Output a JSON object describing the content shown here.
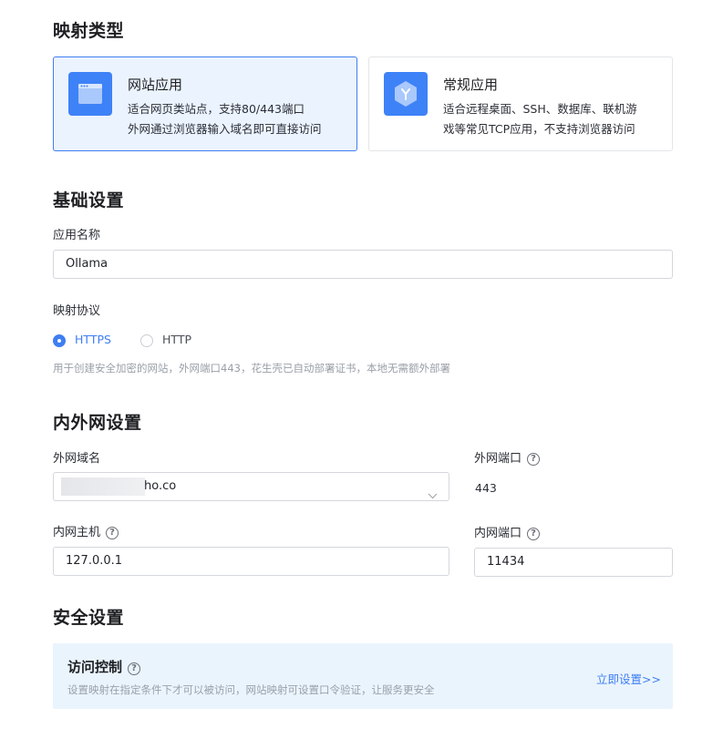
{
  "mapping_type": {
    "title": "映射类型",
    "options": [
      {
        "title": "网站应用",
        "desc_line1": "适合网页类站点，支持80/443端口",
        "desc_line2": "外网通过浏览器输入域名即可直接访问",
        "selected": true,
        "icon": "browser-window-icon"
      },
      {
        "title": "常规应用",
        "desc_line1": "适合远程桌面、SSH、数据库、联机游",
        "desc_line2": "戏等常见TCP应用，不支持浏览器访问",
        "selected": false,
        "icon": "hexagon-y-icon"
      }
    ]
  },
  "basic": {
    "title": "基础设置",
    "app_name_label": "应用名称",
    "app_name_value": "Ollama",
    "protocol_label": "映射协议",
    "protocols": [
      {
        "label": "HTTPS",
        "checked": true
      },
      {
        "label": "HTTP",
        "checked": false
      }
    ],
    "protocol_hint": "用于创建安全加密的网站，外网端口443，花生壳已自动部署证书，本地无需额外部署"
  },
  "network": {
    "title": "内外网设置",
    "external_domain_label": "外网域名",
    "external_domain_value": "ho.co",
    "external_port_label": "外网端口",
    "external_port_value": "443",
    "internal_host_label": "内网主机",
    "internal_host_value": "127.0.0.1",
    "internal_port_label": "内网端口",
    "internal_port_value": "11434"
  },
  "security": {
    "title": "安全设置",
    "access_title": "访问控制",
    "access_desc": "设置映射在指定条件下才可以被访问，网站映射可设置口令验证，让服务更安全",
    "access_link": "立即设置>>"
  },
  "colors": {
    "accent": "#3f7ef2",
    "selected_card_bg": "#ebf3ff",
    "access_box_bg": "#eaf4fd"
  }
}
